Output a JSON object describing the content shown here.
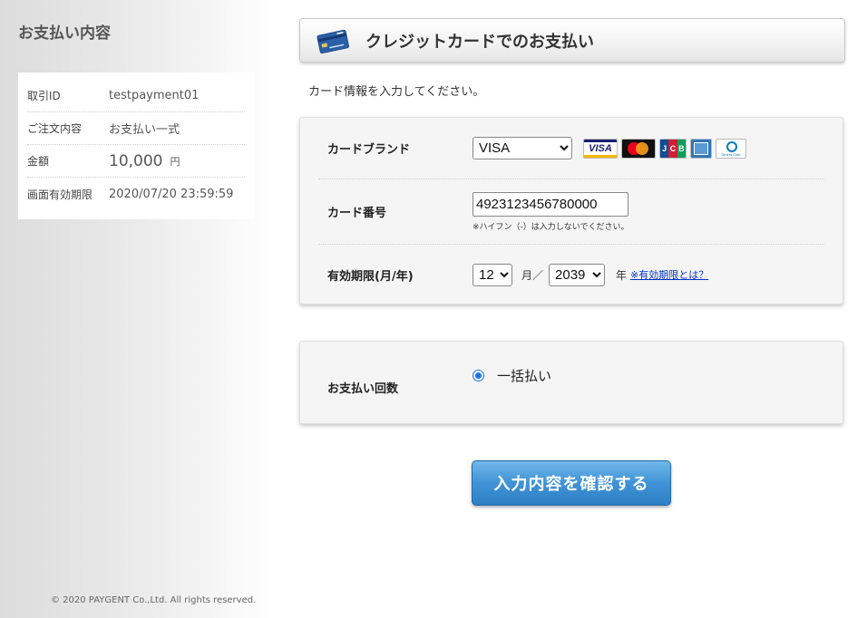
{
  "sidebar": {
    "title": "お支払い内容",
    "summary": {
      "transaction_id": {
        "label": "取引ID",
        "value": "testpayment01"
      },
      "order": {
        "label": "ご注文内容",
        "value": "お支払い一式"
      },
      "amount": {
        "label": "金額",
        "value": "10,000",
        "unit": "円"
      },
      "expiry": {
        "label": "画面有効期限",
        "value": "2020/07/20 23:59:59"
      }
    },
    "copyright": "© 2020 PAYGENT Co.,Ltd. All rights reserved."
  },
  "header": {
    "title": "クレジットカードでのお支払い",
    "icon": "credit-card-icon"
  },
  "intro": "カード情報を入力してください。",
  "card_form": {
    "brand": {
      "label": "カードブランド",
      "selected": "VISA",
      "logos": [
        "VISA",
        "Mastercard",
        "JCB",
        "American Express",
        "Diners Club"
      ],
      "logo_text": {
        "visa": "VISA",
        "jcb": [
          "J",
          "C",
          "B"
        ],
        "diners": "Diners Club"
      }
    },
    "number": {
      "label": "カード番号",
      "value": "4923123456780000",
      "note": "※ハイフン（-）は入力しないでください。"
    },
    "expiry": {
      "label": "有効期限(月/年)",
      "month": "12",
      "month_unit": "月／",
      "year": "2039",
      "year_unit": "年",
      "help_link": "※有効期限とは？"
    }
  },
  "installments": {
    "label": "お支払い回数",
    "option": "一括払い",
    "selected": true
  },
  "confirm_button": {
    "label": "入力内容を確認する"
  },
  "colors": {
    "link": "#0033cc",
    "button": "#3f93d6",
    "radio": "#1a73e8"
  }
}
